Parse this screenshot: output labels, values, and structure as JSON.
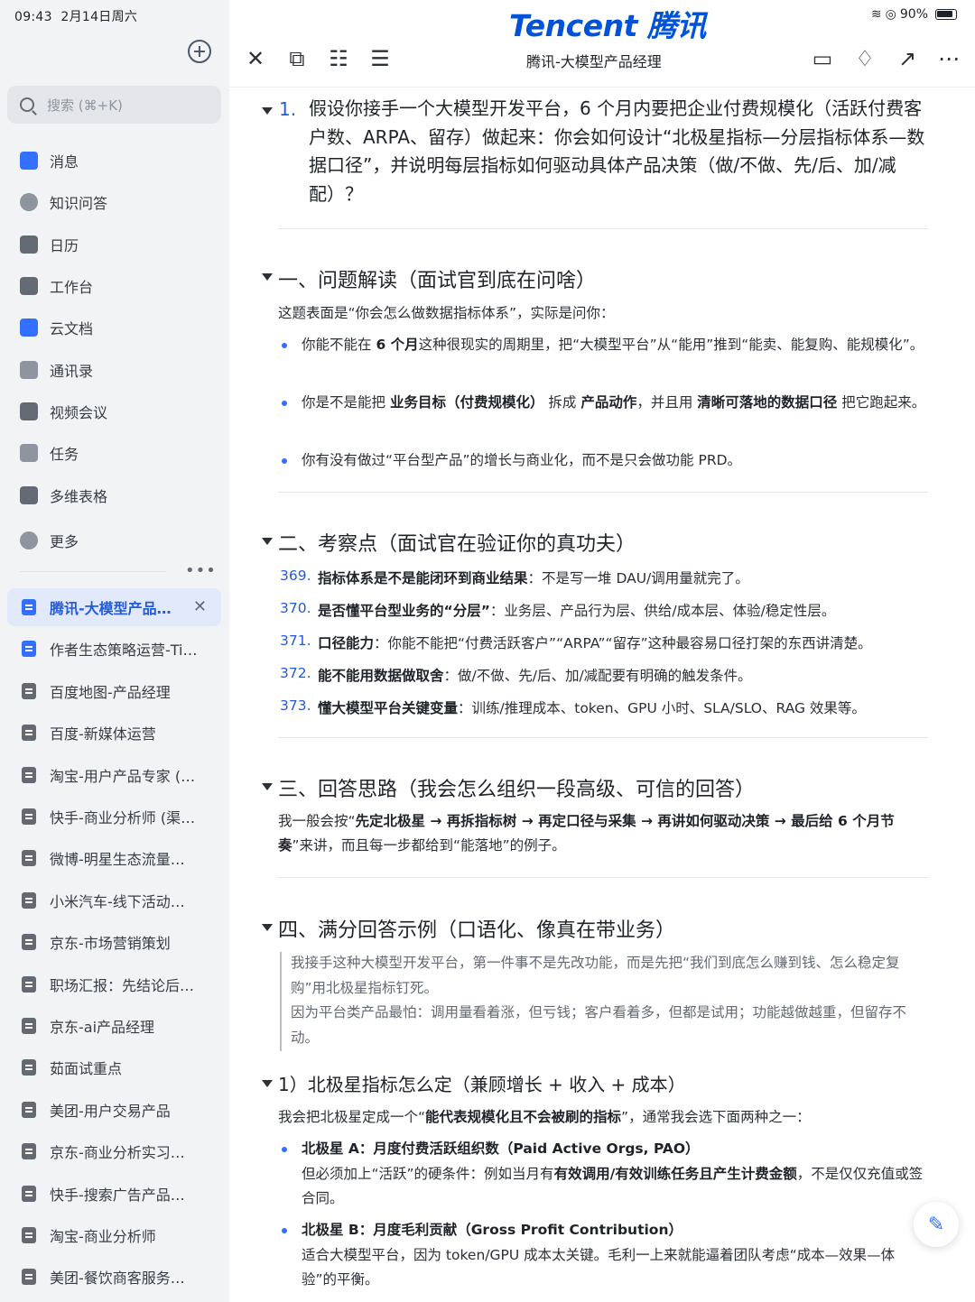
{
  "status": {
    "time": "09:43",
    "date": "2月14日周六",
    "battery": "90%"
  },
  "brand": "Tencent 腾讯",
  "search": {
    "placeholder": "搜索 (⌘+K)"
  },
  "nav": [
    "消息",
    "知识问答",
    "日历",
    "工作台",
    "云文档",
    "通讯录",
    "视频会议",
    "任务",
    "多维表格",
    "更多"
  ],
  "nav_colors": [
    "#3370ff",
    "#8f959e",
    "#646a73",
    "#646a73",
    "#3370ff",
    "#8f959e",
    "#646a73",
    "#8f959e",
    "#646a73",
    "#8f959e"
  ],
  "docs": [
    "腾讯-大模型产品经理",
    "作者生态策略运营-Ti…",
    "百度地图-产品经理",
    "百度-新媒体运营",
    "淘宝-用户产品专家 (…",
    "快手-商业分析师 (渠…",
    "微博-明星生态流量…",
    "小米汽车-线下活动…",
    "京东-市场营销策划",
    "职场汇报：先结论后…",
    "京东-ai产品经理",
    "茹面试重点",
    "美团-用户交易产品",
    "京东-商业分析实习…",
    "快手-搜索广告产品…",
    "淘宝-商业分析师",
    "美团-餐饮商客服务…"
  ],
  "doc_title": "腾讯-大模型产品经理",
  "q": {
    "num": "1.",
    "text": "假设你接手一个大模型开发平台，6 个月内要把企业付费规模化（活跃付费客户数、ARPA、留存）做起来：你会如何设计“北极星指标—分层指标体系—数据口径”，并说明每层指标如何驱动具体产品决策（做/不做、先/后、加/减配）？"
  },
  "sec1": {
    "title": "一、问题解读（面试官到底在问啥）",
    "intro": "这题表面是“你会怎么做数据指标体系”，实际是问你：",
    "items": [
      "你能不能在 <b>6 个月</b>这种很现实的周期里，把“大模型平台”从“能用”推到“能卖、能复购、能规模化”。",
      "你是不是能把 <b>业务目标（付费规模化）</b> 拆成 <b>产品动作</b>，并且用 <b>清晰可落地的数据口径</b> 把它跑起来。",
      "你有没有做过“平台型产品”的增长与商业化，而不是只会做功能 PRD。"
    ]
  },
  "sec2": {
    "title": "二、考察点（面试官在验证你的真功夫）",
    "items": [
      {
        "n": "369.",
        "t": "<b>指标体系是不是能闭环到商业结果</b>：不是写一堆 DAU/调用量就完了。"
      },
      {
        "n": "370.",
        "t": "<b>是否懂平台型业务的“分层”</b>：业务层、产品行为层、供给/成本层、体验/稳定性层。"
      },
      {
        "n": "371.",
        "t": "<b>口径能力</b>：你能不能把“付费活跃客户”“ARPA”“留存”这种最容易口径打架的东西讲清楚。"
      },
      {
        "n": "372.",
        "t": "<b>能不能用数据做取舍</b>：做/不做、先/后、加/减配要有明确的触发条件。"
      },
      {
        "n": "373.",
        "t": "<b>懂大模型平台关键变量</b>：训练/推理成本、token、GPU 小时、SLA/SLO、RAG 效果等。"
      }
    ]
  },
  "sec3": {
    "title": "三、回答思路（我会怎么组织一段高级、可信的回答）",
    "text": "我一般会按“<b>先定北极星 → 再拆指标树 → 再定口径与采集 → 再讲如何驱动决策 → 最后给 6 个月节奏</b>”来讲，而且每一步都给到“能落地”的例子。"
  },
  "sec4": {
    "title": "四、满分回答示例（口语化、像真在带业务）",
    "quote1": "我接手这种大模型开发平台，第一件事不是先改功能，而是先把“我们到底怎么赚到钱、怎么稳定复购”用北极星指标钉死。",
    "quote2": "因为平台类产品最怕：调用量看着涨，但亏钱；客户看着多，但都是试用；功能越做越重，但留存不动。"
  },
  "sec5": {
    "title": "1）北极星指标怎么定（兼顾增长 + 收入 + 成本）",
    "intro": "我会把北极星定成一个“<b>能代表规模化且不会被刷的指标</b>”，通常我会选下面两种之一：",
    "a_title": "北极星 A：月度付费活跃组织数（Paid Active Orgs, PAO）",
    "a_text": "但必须加上“活跃”的硬条件：例如当月有<b>有效调用/有效训练任务且产生计费金额</b>，不是仅仅充值或签合同。",
    "b_title": "北极星 B：月度毛利贡献（Gross Profit Contribution）",
    "b_text": "适合大模型平台，因为 token/GPU 成本太关键。毛利一上来就能逼着团队考虑“成本—效果—体验”的平衡。"
  }
}
